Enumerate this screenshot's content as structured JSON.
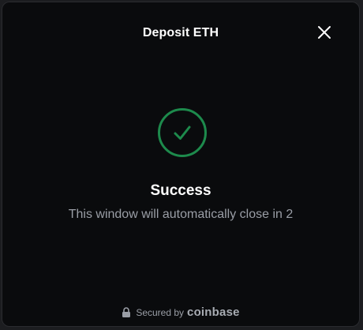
{
  "modal": {
    "title": "Deposit ETH",
    "close_icon": "close-icon"
  },
  "status": {
    "icon": "checkmark-circle-icon",
    "title": "Success",
    "message": "This window will automatically close in 2"
  },
  "footer": {
    "lock_icon": "lock-icon",
    "secured_text": "Secured by",
    "brand": "coinbase"
  },
  "colors": {
    "background": "#0a0b0d",
    "success_green": "#1d8a4c",
    "muted_text": "#9a9ea6"
  }
}
